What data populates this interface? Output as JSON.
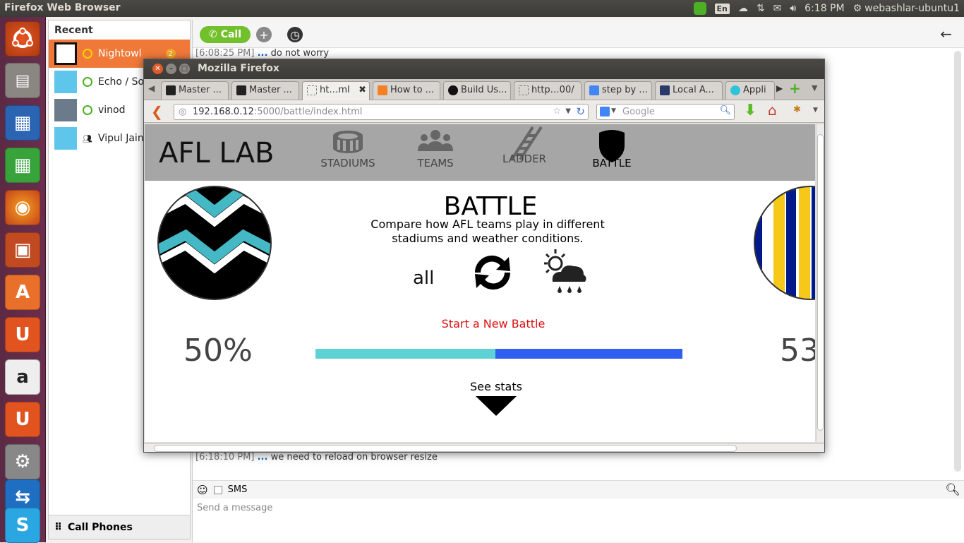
{
  "topbar": {
    "title": "Firefox Web Browser",
    "lang": "En",
    "time": "6:18 PM",
    "user": "webashlar-ubuntu1"
  },
  "skype": {
    "recent_label": "Recent",
    "contacts": [
      {
        "name": "Nightowl",
        "badge": "2"
      },
      {
        "name": "Echo / So"
      },
      {
        "name": "vinod"
      },
      {
        "name": "Vipul Jain"
      }
    ],
    "call_phones": "Call Phones",
    "call_label": "Call",
    "messages": [
      {
        "time": "[6:08:25 PM]",
        "dots": "...",
        "text": "do not worry"
      },
      {
        "time": "[6:18:10 PM]",
        "dots": "...",
        "text": "we need to reload on browser resize"
      }
    ],
    "sms_label": "SMS",
    "send_placeholder": "Send a message"
  },
  "firefox": {
    "window_title": "Mozilla Firefox",
    "tabs": [
      "Master ...",
      "Master ...",
      "ht…ml",
      "How to ...",
      "Build Us...",
      "http…00/",
      "step by ...",
      "Local A...",
      "Appli"
    ],
    "url_host": "192.168.0.12",
    "url_rest": ":5000/battle/index.html",
    "search_placeholder": "Google"
  },
  "app": {
    "logo": "AFL LAB",
    "nav": [
      "STADIUMS",
      "TEAMS",
      "LADDER",
      "BATTLE"
    ],
    "title": "BATTLE",
    "desc_line1": "Compare how AFL teams play in different",
    "desc_line2": "stadiums and weather conditions.",
    "filter": "all",
    "new_battle": "Start a New Battle",
    "left_pct": "50%",
    "right_pct": "53",
    "see_stats": "See stats",
    "bar_left_fraction": 0.49,
    "colors": {
      "bar_left": "#5ed1d4",
      "bar_right": "#2f5ef0",
      "header": "#a6a6a6",
      "link": "#dd1111"
    }
  }
}
